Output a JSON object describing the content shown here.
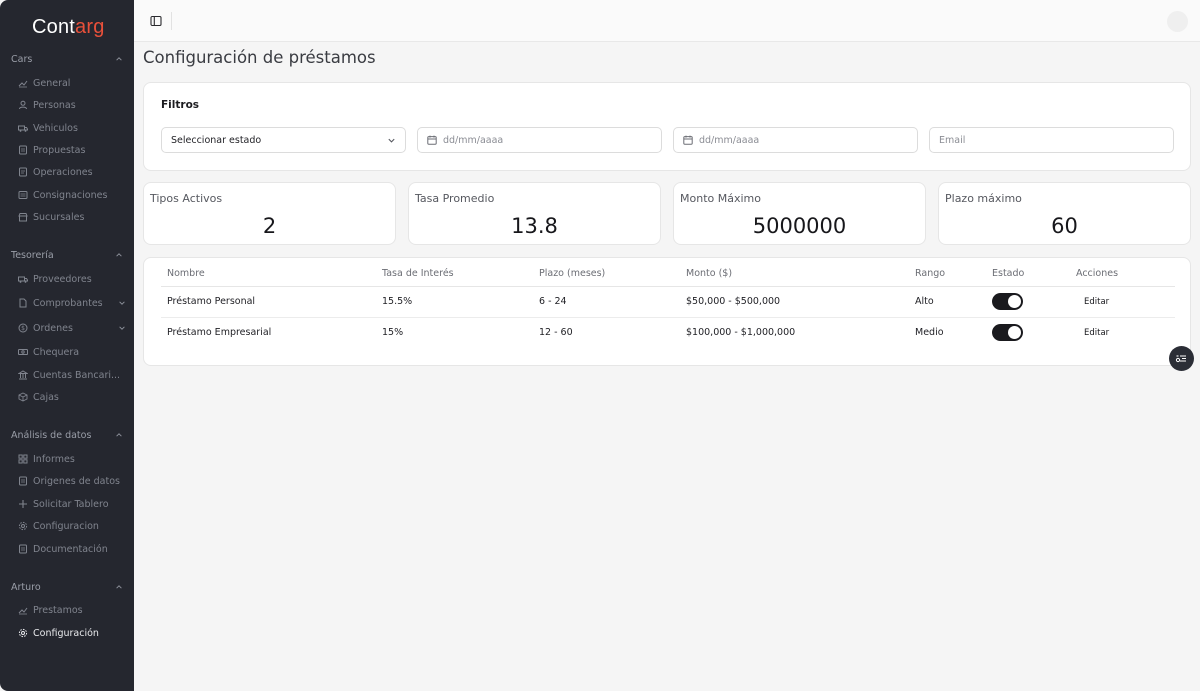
{
  "brand": {
    "name_main": "Cont",
    "name_accent": "arg",
    "accent_color": "#e8503a"
  },
  "sidebar": {
    "sections": [
      {
        "title": "Cars",
        "items": [
          {
            "label": "General",
            "icon": "chart-icon"
          },
          {
            "label": "Personas",
            "icon": "user-icon"
          },
          {
            "label": "Vehiculos",
            "icon": "truck-icon"
          },
          {
            "label": "Propuestas",
            "icon": "document-icon"
          },
          {
            "label": "Operaciones",
            "icon": "document-icon"
          },
          {
            "label": "Consignaciones",
            "icon": "newspaper-icon"
          },
          {
            "label": "Sucursales",
            "icon": "store-icon"
          }
        ]
      },
      {
        "title": "Tesorería",
        "items": [
          {
            "label": "Proveedores",
            "icon": "truck-icon"
          },
          {
            "label": "Comprobantes",
            "icon": "file-icon"
          },
          {
            "label": "Ordenes",
            "icon": "dollar-icon"
          },
          {
            "label": "Chequera",
            "icon": "banknote-icon"
          },
          {
            "label": "Cuentas Bancari...",
            "icon": "bank-icon"
          },
          {
            "label": "Cajas",
            "icon": "box-icon"
          }
        ]
      },
      {
        "title": "Análisis de datos",
        "items": [
          {
            "label": "Informes",
            "icon": "grid-icon"
          },
          {
            "label": "Origenes de datos",
            "icon": "document-icon"
          },
          {
            "label": "Solicitar Tablero",
            "icon": "plus-icon"
          },
          {
            "label": "Configuracion",
            "icon": "gear-icon"
          },
          {
            "label": "Documentación",
            "icon": "document-icon"
          }
        ]
      },
      {
        "title": "Arturo",
        "items": [
          {
            "label": "Prestamos",
            "icon": "chart-icon"
          },
          {
            "label": "Configuración",
            "icon": "gear-icon",
            "active": true
          }
        ]
      }
    ]
  },
  "page": {
    "title": "Configuración de préstamos"
  },
  "filters": {
    "title": "Filtros",
    "estado_select": "Seleccionar estado",
    "date_from_placeholder": "dd/mm/aaaa",
    "date_to_placeholder": "dd/mm/aaaa",
    "email_placeholder": "Email"
  },
  "stats": [
    {
      "label": "Tipos Activos",
      "value": "2"
    },
    {
      "label": "Tasa Promedio",
      "value": "13.8"
    },
    {
      "label": "Monto Máximo",
      "value": "5000000"
    },
    {
      "label": "Plazo máximo",
      "value": "60"
    }
  ],
  "table": {
    "columns": [
      "Nombre",
      "Tasa de Interés",
      "Plazo (meses)",
      "Monto ($)",
      "Rango",
      "Estado",
      "Acciones"
    ],
    "rows": [
      {
        "nombre": "Préstamo Personal",
        "tasa": "15.5%",
        "plazo": "6 - 24",
        "monto": "$50,000 - $500,000",
        "rango": "Alto",
        "estado_on": true,
        "accion": "Editar"
      },
      {
        "nombre": "Préstamo Empresarial",
        "tasa": "15%",
        "plazo": "12 - 60",
        "monto": "$100,000 - $1,000,000",
        "rango": "Medio",
        "estado_on": true,
        "accion": "Editar"
      }
    ]
  }
}
